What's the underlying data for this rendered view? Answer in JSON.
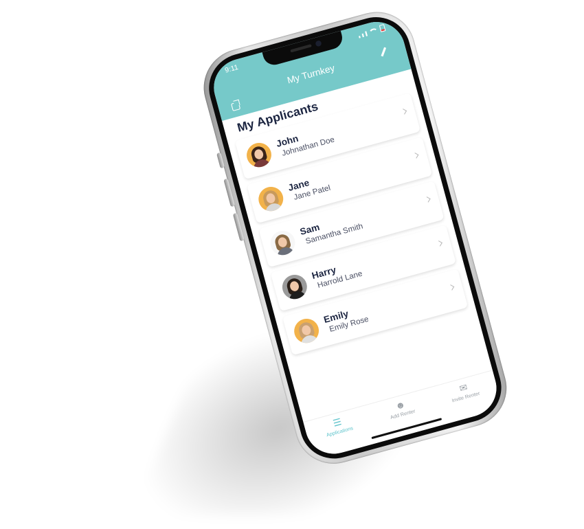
{
  "status_bar": {
    "time": "9:11"
  },
  "header": {
    "title": "My Turnkey",
    "background_color": "#76c9c9"
  },
  "section": {
    "title": "My Applicants"
  },
  "applicants": [
    {
      "name": "John",
      "full_name": "Johnathan Doe",
      "avatar_bg": "#f2b24a",
      "hair": "#3a2418",
      "shirt": "#7a3a3a"
    },
    {
      "name": "Jane",
      "full_name": "Jane Patel",
      "avatar_bg": "#f2b24a",
      "hair": "#c89a5c",
      "shirt": "#d8d8d8"
    },
    {
      "name": "Sam",
      "full_name": "Samantha Smith",
      "avatar_bg": "#f7f7f7",
      "hair": "#8a6a45",
      "shirt": "#6b6f7a"
    },
    {
      "name": "Harry",
      "full_name": "Harrold Lane",
      "avatar_bg": "#9a9a9a",
      "hair": "#2a1f18",
      "shirt": "#1e1e1e"
    },
    {
      "name": "Emily",
      "full_name": "Emily Rose",
      "avatar_bg": "#f2b24a",
      "hair": "#c9a070",
      "shirt": "#e0e0e0"
    }
  ],
  "tabs": [
    {
      "label": "Applications",
      "icon": "list-icon",
      "color": "#5fc4cc"
    },
    {
      "label": "Add Renter",
      "icon": "add-person-icon",
      "color": "#9aa0a6"
    },
    {
      "label": "Invite Renter",
      "icon": "chat-icon",
      "color": "#9aa0a6"
    }
  ]
}
